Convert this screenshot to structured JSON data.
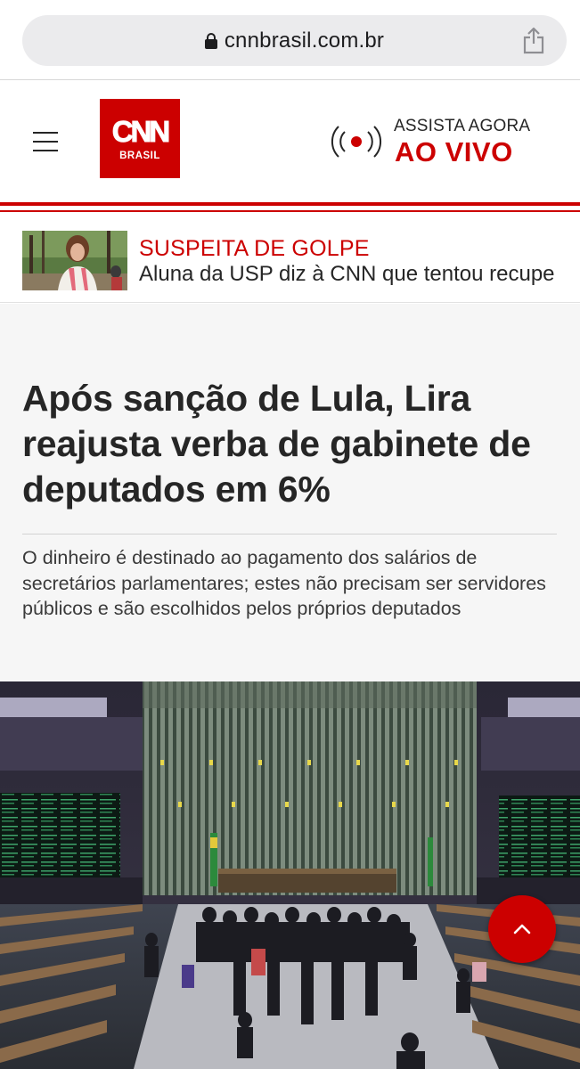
{
  "browser": {
    "url": "cnnbrasil.com.br",
    "lock_icon": "lock-icon",
    "share_icon": "share-icon"
  },
  "header": {
    "menu_icon": "hamburger-menu-icon",
    "logo": {
      "main": "CNN",
      "sub": "BRASIL",
      "color": "#cc0000"
    },
    "live": {
      "icon": "live-broadcast-icon",
      "label_top": "ASSISTA AGORA",
      "label_bottom": "AO VIVO"
    }
  },
  "breaking": {
    "tag": "SUSPEITA DE GOLPE",
    "text": "Aluna da USP diz à CNN que tentou recupe"
  },
  "article": {
    "headline": "Após sanção de Lula, Lira reajusta verba de gabinete de deputados em 6%",
    "summary": "O dinheiro é destinado ao pagamento dos salários de secretários parlamentares; estes não precisam ser servidores públicos e são escolhidos pelos próprios deputados"
  },
  "back_to_top": {
    "icon": "chevron-up-icon"
  },
  "colors": {
    "brand_red": "#cc0000",
    "text_dark": "#262626",
    "article_bg": "#f6f6f6"
  }
}
